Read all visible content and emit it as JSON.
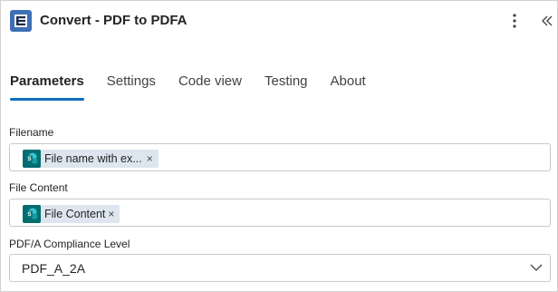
{
  "header": {
    "title": "Convert - PDF to PDFA",
    "logo_icon": "encodian-logo-icon",
    "more_icon": "more-vertical-icon",
    "collapse_icon": "double-chevron-left-icon"
  },
  "tabs": [
    {
      "label": "Parameters",
      "active": true
    },
    {
      "label": "Settings",
      "active": false
    },
    {
      "label": "Code view",
      "active": false
    },
    {
      "label": "Testing",
      "active": false
    },
    {
      "label": "About",
      "active": false
    }
  ],
  "fields": {
    "filename": {
      "label": "Filename",
      "token_text": "File name with ex...",
      "token_icon": "sharepoint-icon",
      "remove_glyph": "×"
    },
    "file_content": {
      "label": "File Content",
      "token_text": "File Content",
      "token_icon": "sharepoint-icon",
      "remove_glyph": "×"
    },
    "compliance_level": {
      "label": "PDF/A Compliance Level",
      "value": "PDF_A_2A"
    }
  },
  "colors": {
    "accent": "#0f6cbd",
    "token_bg": "#dde6ee",
    "sharepoint": "#036c70",
    "logo": "#3f6fb7"
  }
}
